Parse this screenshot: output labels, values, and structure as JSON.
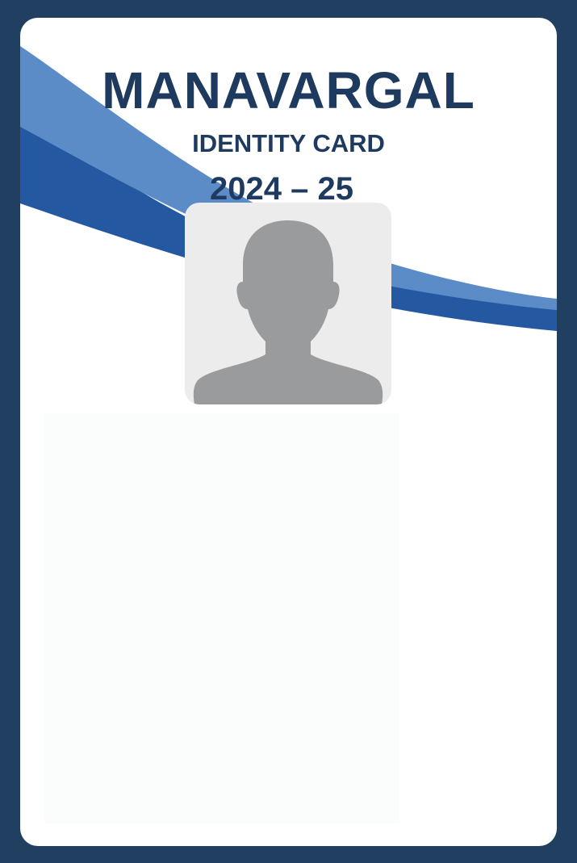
{
  "card": {
    "organization": "MANAVARGAL",
    "card_type": "IDENTITY CARD",
    "academic_year": "2024 – 25"
  },
  "photo": {
    "icon": "person-silhouette-icon"
  },
  "colors": {
    "frame": "#213f61",
    "card_background": "#ffffff",
    "title_text": "#1e3a5f",
    "swoosh_light": "#5b8cc8",
    "swoosh_dark": "#2458a0",
    "photo_background": "#ececec",
    "silhouette": "#9a9b9d"
  }
}
